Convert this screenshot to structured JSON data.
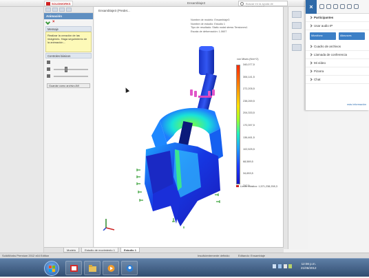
{
  "app": {
    "logo_text": "SOLIDWORKS",
    "doc_title": "Ensamblaje3",
    "search_placeholder": "Buscar en la ayuda de SOLIDWORKS"
  },
  "property_manager": {
    "title": "Animación",
    "message_header": "Mensaje",
    "message_text": "Realizar la creación de las imágenes. Haga seguimiento de la animación...",
    "group_header": "Controles básicos",
    "button_label": "Guardar como archivo AVI"
  },
  "viewport": {
    "title": "Ensamblaje3 (Predet...",
    "info_lines": [
      "Nombre de modelo: Ensamblaje3",
      "Nombre de estudio: Estudio 1",
      "Tipo de resultado: Static nodal stress Tensiones1",
      "Escala de deformación: 1.0607"
    ],
    "legend_title": "von Mises (N/m^2)",
    "legend_ticks": [
      "340,077,5",
      "306,141,5",
      "272,205,5",
      "238,269,5",
      "204,333,5",
      "170,397,5",
      "136,461,5",
      "102,525,5",
      "68,589,5",
      "34,653,5",
      "717,5"
    ],
    "yield_limit": "Límite elástico: 1,571,238,208,3"
  },
  "lync": {
    "participants_header": "Participantes",
    "audio_label": "Usar audio IP",
    "mic_button": "Micrófono",
    "speaker_button": "Altavoces",
    "items": [
      "Cuadro de archivos",
      "Llamada de conferencia",
      "Mi vídeo",
      "Pizarra",
      "Chat"
    ],
    "more_link": "más información"
  },
  "bottom_tabs": [
    "Modelo",
    "Estudio de movimiento 1",
    "Estudio 1"
  ],
  "status": {
    "left": "SolidWorks Premium 2012 x64 Edition",
    "middle": "Insuficientemente definido",
    "middle2": "Editando: Ensamblaje"
  },
  "taskbar": {
    "time": "12:08 p.m.",
    "date": "21/06/2012"
  },
  "colors": {
    "accent": "#2f6aa8",
    "pm_header": "#5f8fc1",
    "message_bg": "#fdf9b8"
  }
}
